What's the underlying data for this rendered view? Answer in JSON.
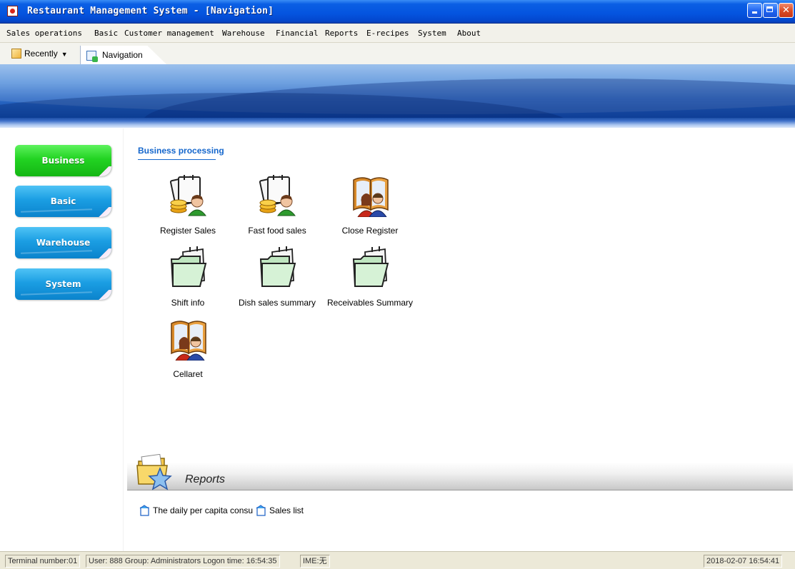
{
  "window": {
    "title": "Restaurant Management System - [Navigation]",
    "buttons": [
      "minimize-icon",
      "restore-icon",
      "close-icon"
    ]
  },
  "menu": [
    "Sales operations",
    "Basic",
    "Customer management",
    "Warehouse",
    "Financial",
    "Reports",
    "E-recipes",
    "System",
    "About"
  ],
  "tabs": {
    "recently": "Recently",
    "navigation": "Navigation"
  },
  "sidebar": {
    "items": [
      {
        "label": "Business processing",
        "active": true
      },
      {
        "label": "Basic",
        "active": false
      },
      {
        "label": "Warehouse",
        "active": false
      },
      {
        "label": "System",
        "active": false
      }
    ]
  },
  "main": {
    "section_title": "Business processing",
    "tiles": [
      {
        "label": "Register Sales",
        "icon": "register-sales-icon"
      },
      {
        "label": "Fast food sales",
        "icon": "fast-food-sales-icon"
      },
      {
        "label": "Close Register",
        "icon": "close-register-icon"
      },
      {
        "label": "Shift info",
        "icon": "folder-icon"
      },
      {
        "label": "Dish sales summary",
        "icon": "folder-icon"
      },
      {
        "label": "Receivables Summary",
        "icon": "folder-icon"
      },
      {
        "label": "Cellaret",
        "icon": "book-people-icon"
      }
    ],
    "reports": {
      "title": "Reports",
      "links": [
        "The daily per capita consu",
        "Sales list"
      ]
    }
  },
  "status": {
    "session": "Terminal number:01",
    "user": "User: 888 Group: Administrators Logon time: 16:54:35",
    "ime": "IME:无",
    "datetime": "2018-02-07 16:54:41"
  },
  "colors": {
    "titlebar": "#0454df",
    "sidebar_active": "#22d322",
    "sidebar_inactive": "#1b9ee3",
    "section_title": "#1466cc"
  }
}
